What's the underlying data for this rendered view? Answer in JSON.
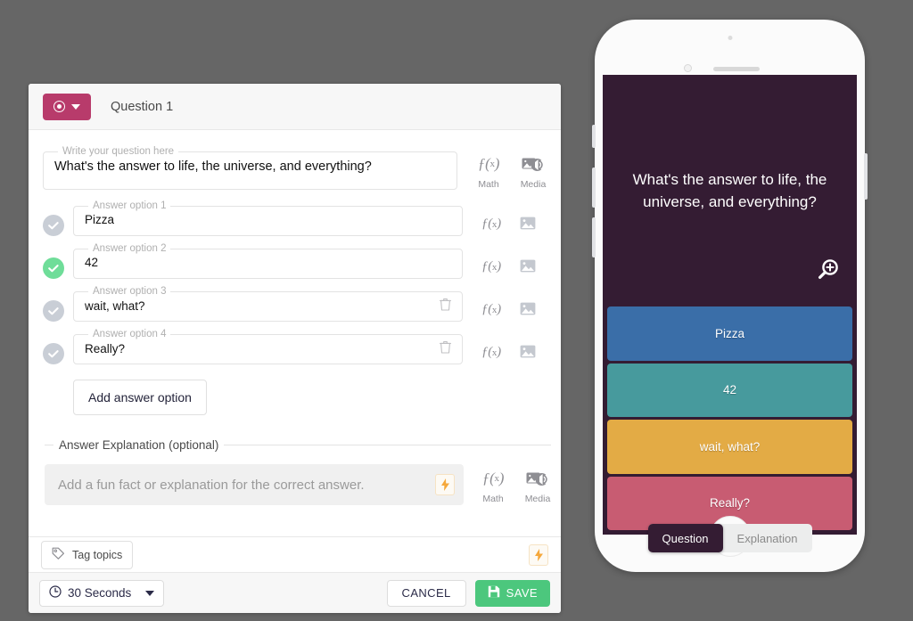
{
  "editor": {
    "header": {
      "question_type_icon": "radio-target-icon",
      "title": "Question 1"
    },
    "question_field": {
      "legend": "Write your question here",
      "value": "What's the answer to life, the universe, and everything?"
    },
    "tools": {
      "math_label": "Math",
      "math_glyph": "f(x)",
      "media_label": "Media",
      "media_icon": "image-audio-icon"
    },
    "answers": [
      {
        "legend": "Answer option 1",
        "value": "Pizza",
        "correct": false,
        "deletable": false
      },
      {
        "legend": "Answer option 2",
        "value": "42",
        "correct": true,
        "deletable": false
      },
      {
        "legend": "Answer option 3",
        "value": "wait, what?",
        "correct": false,
        "deletable": true
      },
      {
        "legend": "Answer option 4",
        "value": "Really?",
        "correct": false,
        "deletable": true
      }
    ],
    "add_answer_label": "Add answer option",
    "explanation": {
      "legend": "Answer Explanation (optional)",
      "placeholder": "Add a fun fact or explanation for the correct answer.",
      "value": ""
    },
    "tag_topics_label": "Tag topics",
    "footer": {
      "timer_value": "30 Seconds",
      "cancel_label": "CANCEL",
      "save_label": "SAVE"
    }
  },
  "phone": {
    "question_text": "What's the answer to life, the universe, and everything?",
    "zoom_icon": "magnifier-plus-icon",
    "answers": [
      {
        "label": "Pizza",
        "color": "#3a6ea8"
      },
      {
        "label": "42",
        "color": "#479a9d"
      },
      {
        "label": "wait, what?",
        "color": "#e3ab45"
      },
      {
        "label": "Really?",
        "color": "#c85c72"
      }
    ],
    "toggle": {
      "question_label": "Question",
      "explanation_label": "Explanation"
    }
  },
  "colors": {
    "brand_magenta": "#b83b6b",
    "correct_green": "#6fdd99",
    "save_green": "#4cc77d",
    "screen_bg": "#341c33",
    "bolt_orange": "#f5a83c"
  }
}
